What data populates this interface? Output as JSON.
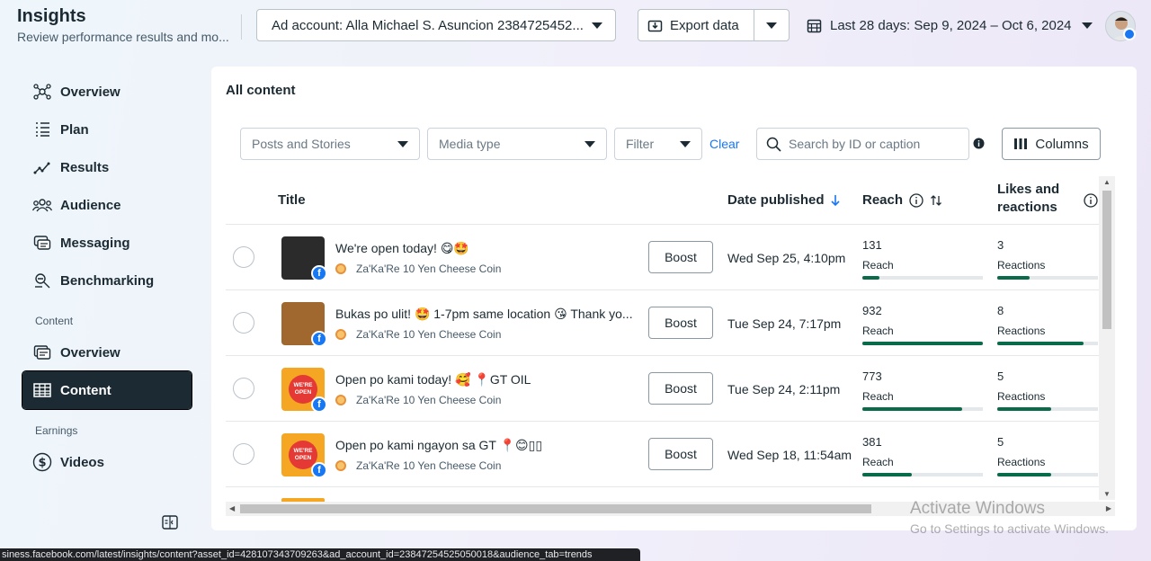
{
  "header": {
    "title": "Insights",
    "subtitle": "Review performance results and mo...",
    "account_label": "Ad account: Alla Michael S. Asuncion 2384725452...",
    "export_label": "Export data",
    "date_range": "Last 28 days: Sep 9, 2024 – Oct 6, 2024"
  },
  "sidebar": {
    "items": [
      {
        "label": "Overview",
        "icon": "network-icon"
      },
      {
        "label": "Plan",
        "icon": "list-icon"
      },
      {
        "label": "Results",
        "icon": "trend-line-icon"
      },
      {
        "label": "Audience",
        "icon": "people-icon"
      },
      {
        "label": "Messaging",
        "icon": "chat-icon"
      },
      {
        "label": "Benchmarking",
        "icon": "benchmark-icon"
      }
    ],
    "content_section": "Content",
    "content_items": [
      {
        "label": "Overview",
        "icon": "gallery-icon"
      },
      {
        "label": "Content",
        "icon": "table-icon"
      }
    ],
    "earnings_section": "Earnings",
    "earnings_items": [
      {
        "label": "Videos",
        "icon": "dollar-circle-icon"
      }
    ]
  },
  "main": {
    "title": "All content",
    "filters": {
      "posts_stories": "Posts and Stories",
      "media_type": "Media type",
      "filter": "Filter",
      "clear": "Clear",
      "search_placeholder": "Search by ID or caption",
      "columns": "Columns"
    },
    "table": {
      "headers": {
        "title": "Title",
        "date": "Date published",
        "reach": "Reach",
        "likes": "Likes and",
        "likes2": "reactions"
      },
      "rows": [
        {
          "caption": "We're open today! 😋🤩",
          "page": "Za'Ka'Re 10 Yen Cheese Coin",
          "boost": "Boost",
          "date": "Wed Sep 25, 4:10pm",
          "reach": "131",
          "reach_label": "Reach",
          "reach_fraction": 0.14,
          "reactions": "3",
          "reactions_label": "Reactions",
          "reactions_fraction": 0.32,
          "thumb_color": "#2b2b2b"
        },
        {
          "caption": "Bukas po ulit! 🤩 1-7pm same location 😘 Thank yo...",
          "page": "Za'Ka'Re 10 Yen Cheese Coin",
          "boost": "Boost",
          "date": "Tue Sep 24, 7:17pm",
          "reach": "932",
          "reach_label": "Reach",
          "reach_fraction": 1.0,
          "reactions": "8",
          "reactions_label": "Reactions",
          "reactions_fraction": 0.86,
          "thumb_color": "#a0682e"
        },
        {
          "caption": "Open po kami today! 🥰 📍GT OIL",
          "page": "Za'Ka'Re 10 Yen Cheese Coin",
          "boost": "Boost",
          "date": "Tue Sep 24, 2:11pm",
          "reach": "773",
          "reach_label": "Reach",
          "reach_fraction": 0.83,
          "reactions": "5",
          "reactions_label": "Reactions",
          "reactions_fraction": 0.54,
          "thumb_color": "#f5a623",
          "thumb_text": "WE'RE OPEN"
        },
        {
          "caption": "Open po kami ngayon sa GT 📍😊▯▯",
          "page": "Za'Ka'Re 10 Yen Cheese Coin",
          "boost": "Boost",
          "date": "Wed Sep 18, 11:54am",
          "reach": "381",
          "reach_label": "Reach",
          "reach_fraction": 0.41,
          "reactions": "5",
          "reactions_label": "Reactions",
          "reactions_fraction": 0.54,
          "thumb_color": "#f5a623",
          "thumb_text": "WE'RE OPEN"
        }
      ]
    }
  },
  "watermark": {
    "line1": "Activate Windows",
    "line2": "Go to Settings to activate Windows."
  },
  "status_url": "siness.facebook.com/latest/insights/content?asset_id=428107343709263&ad_account_id=23847254525050018&audience_tab=trends",
  "colors": {
    "accent": "#1877f2",
    "bar": "#0a6b4b",
    "active_nav": "#1c2b33"
  }
}
